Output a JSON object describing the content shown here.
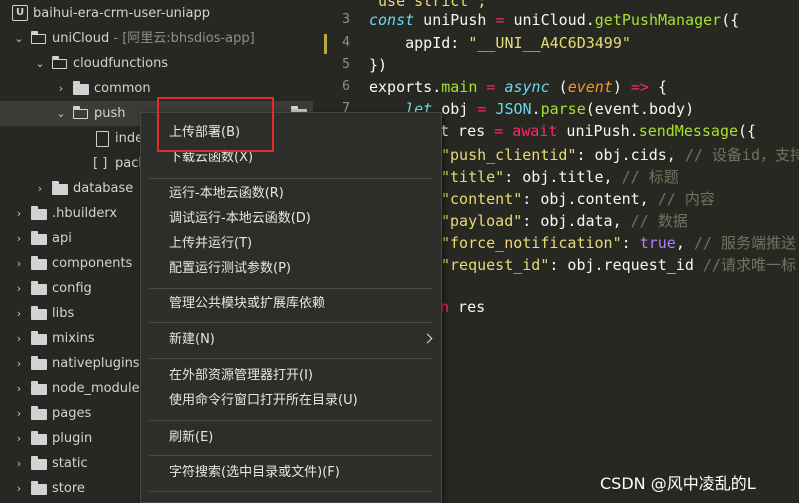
{
  "sidebar": {
    "project": "baihui-era-crm-user-uniapp",
    "unicloud_label": "uniCloud",
    "unicloud_suffix": " - [阿里云:bhsdios-app]",
    "cloudfunctions": "cloudfunctions",
    "common": "common",
    "push": "push",
    "index_file": "inde",
    "package_file": "pacl",
    "database": "database",
    "folders": [
      ".hbuilderx",
      "api",
      "components",
      "config",
      "libs",
      "mixins",
      "nativeplugins",
      "node_modules",
      "pages",
      "plugin",
      "static",
      "store"
    ]
  },
  "editor": {
    "line_numbers": [
      "3",
      "4",
      "5",
      "6",
      "7"
    ],
    "line1": {
      "a": "'use strict';"
    },
    "line3": {
      "kw": "const",
      "a": " uniPush ",
      "op": "=",
      "b": " uniCloud.",
      "fn": "getPushManager",
      "c": "({"
    },
    "line4": {
      "a": "    appId: ",
      "st": "\"__UNI__A4C6D3499\""
    },
    "line5": {
      "a": "})"
    },
    "line6": {
      "a": "exports.",
      "fn1": "main",
      "b": " ",
      "op1": "=",
      "c": " ",
      "kw": "async",
      "d": " (",
      "par": "event",
      "e": ") ",
      "op2": "=>",
      "f": " {"
    },
    "line7": {
      "a": "    ",
      "kw": "let",
      "b": " obj ",
      "op": "=",
      "c": " ",
      "kw2": "JSON",
      "d": ".",
      "fn": "parse",
      "e": "(event.body)"
    },
    "line8": {
      "a": "t res ",
      "op": "=",
      "b": " ",
      "kw": "await",
      "c": " uniPush.",
      "fn": "sendMessage",
      "d": "({"
    },
    "line9": {
      "st": "\"push_clientid\"",
      "a": ": obj.cids, ",
      "cm": "// 设备id，支持"
    },
    "line10": {
      "st": "\"title\"",
      "a": ": obj.title, ",
      "cm": "// 标题"
    },
    "line11": {
      "st": "\"content\"",
      "a": ": obj.content, ",
      "cm": "// 内容"
    },
    "line12": {
      "st": "\"payload\"",
      "a": ": obj.data, ",
      "cm": "// 数据"
    },
    "line13": {
      "st": "\"force_notification\"",
      "a": ": ",
      "bl": "true",
      "b": ", ",
      "cm": "// 服务端推送"
    },
    "line14": {
      "st": "\"request_id\"",
      "a": ": obj.request_id ",
      "cm": "//请求唯一标"
    },
    "line16": {
      "op": "n",
      "a": " res"
    }
  },
  "menu": {
    "items": [
      "上传部署(B)",
      "下载云函数(X)",
      "运行-本地云函数(R)",
      "调试运行-本地云函数(D)",
      "上传并运行(T)",
      "配置运行测试参数(P)",
      "管理公共模块或扩展库依赖",
      "新建(N)",
      "在外部资源管理器打开(I)",
      "使用命令行窗口打开所在目录(U)",
      "刷新(E)",
      "字符搜索(选中目录或文件)(F)"
    ]
  },
  "watermark": "CSDN @风中凌乱的L",
  "colors": {
    "highlight": "#e22c2c",
    "keyword": "#66d9ef",
    "string": "#e6db74",
    "function": "#a6e22e",
    "operator": "#f92672"
  }
}
